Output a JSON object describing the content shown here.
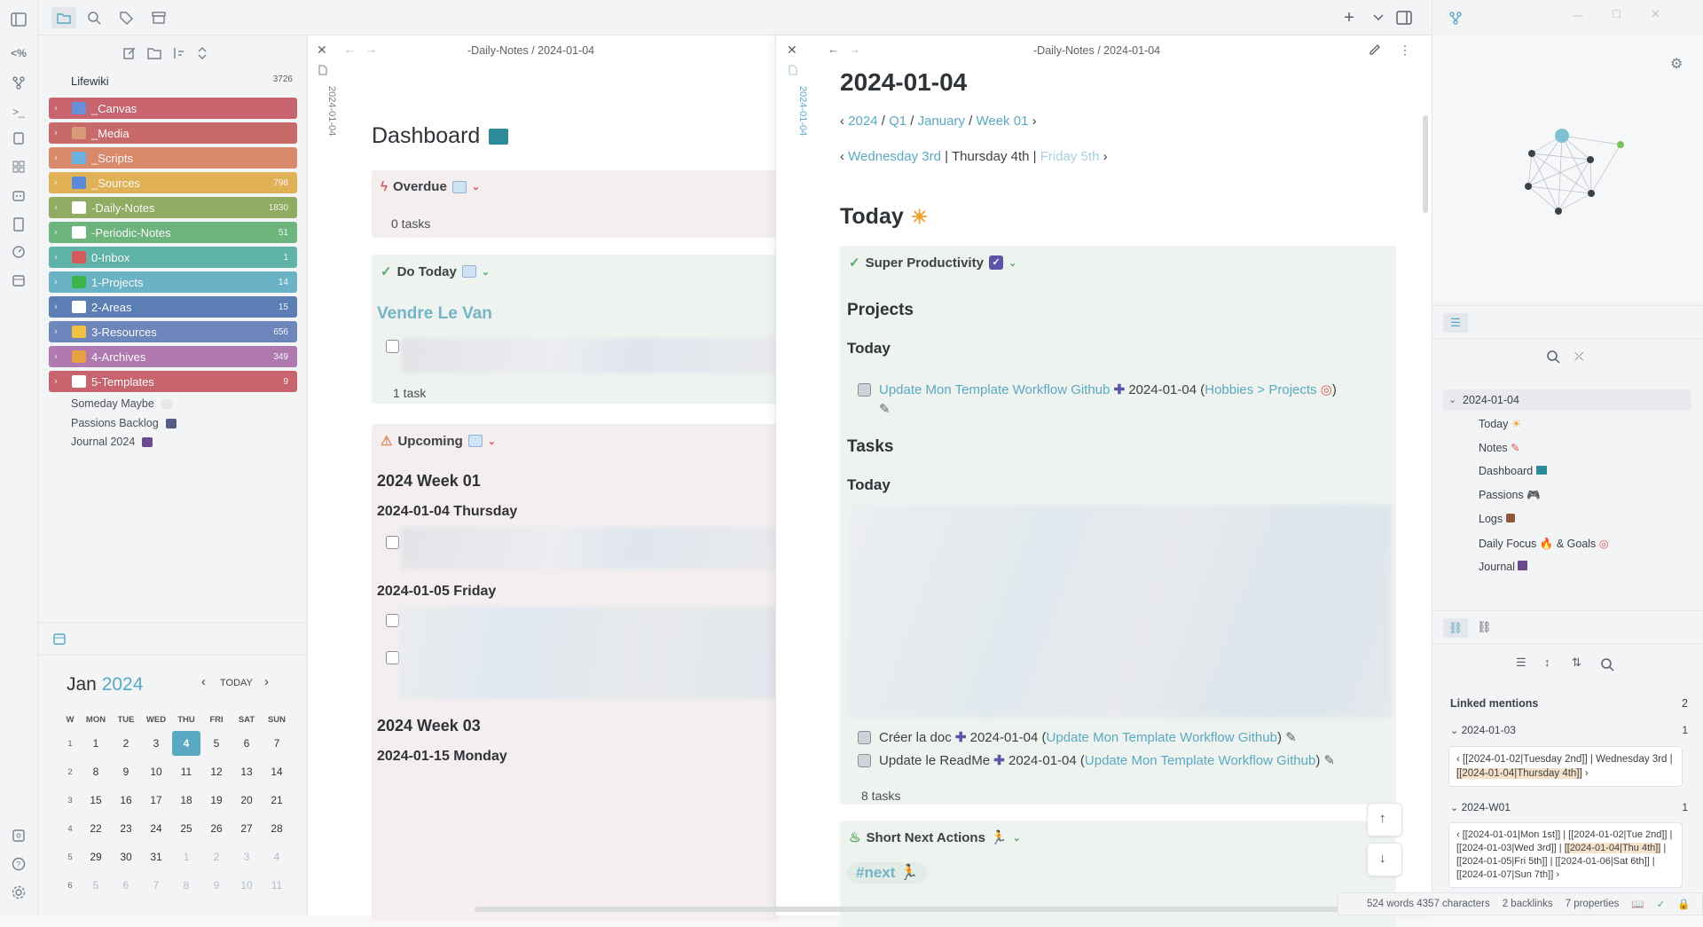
{
  "vault": {
    "name": "Lifewiki",
    "count": "3726"
  },
  "folders": [
    {
      "name": "_Canvas",
      "count": "",
      "color": "#c7646e",
      "icon_color": "#6a8fd9"
    },
    {
      "name": "_Media",
      "count": "",
      "color": "#c96a6a",
      "icon_color": "#d99a7a"
    },
    {
      "name": "_Scripts",
      "count": "",
      "color": "#d98a6a",
      "icon_color": "#6ab0e0"
    },
    {
      "name": "_Sources",
      "count": "798",
      "color": "#e0b255",
      "icon_color": "#5a8ad9"
    },
    {
      "name": "-Daily-Notes",
      "count": "1830",
      "color": "#8fac62",
      "icon_color": "#ffffff"
    },
    {
      "name": "-Periodic-Notes",
      "count": "51",
      "color": "#6cb57d",
      "icon_color": "#ffffff"
    },
    {
      "name": "0-Inbox",
      "count": "1",
      "color": "#5fb3a8",
      "icon_color": "#d65a5a"
    },
    {
      "name": "1-Projects",
      "count": "14",
      "color": "#6ab3c6",
      "icon_color": "#3bb54a"
    },
    {
      "name": "2-Areas",
      "count": "15",
      "color": "#5b7fb5",
      "icon_color": "#ffffff"
    },
    {
      "name": "3-Resources",
      "count": "656",
      "color": "#6d86bb",
      "icon_color": "#f0c040"
    },
    {
      "name": "4-Archives",
      "count": "349",
      "color": "#b07ab0",
      "icon_color": "#e8a040"
    },
    {
      "name": "5-Templates",
      "count": "9",
      "color": "#c7646e",
      "icon_color": "#ffffff"
    }
  ],
  "files": [
    {
      "name": "Someday Maybe",
      "emoji_color": "#e8e8ea"
    },
    {
      "name": "Passions Backlog",
      "emoji_color": "#555a88"
    },
    {
      "name": "Journal 2024",
      "emoji_color": "#6a4a8a"
    }
  ],
  "calendar": {
    "month": "Jan",
    "year": "2024",
    "today_label": "TODAY",
    "weekdays": [
      "W",
      "MON",
      "TUE",
      "WED",
      "THU",
      "FRI",
      "SAT",
      "SUN"
    ],
    "weeks": [
      [
        "1",
        "1",
        "2",
        "3",
        "4",
        "5",
        "6",
        "7"
      ],
      [
        "2",
        "8",
        "9",
        "10",
        "11",
        "12",
        "13",
        "14"
      ],
      [
        "3",
        "15",
        "16",
        "17",
        "18",
        "19",
        "20",
        "21"
      ],
      [
        "4",
        "22",
        "23",
        "24",
        "25",
        "26",
        "27",
        "28"
      ],
      [
        "5",
        "29",
        "30",
        "31",
        "1",
        "2",
        "3",
        "4"
      ],
      [
        "6",
        "5",
        "6",
        "7",
        "8",
        "9",
        "10",
        "11"
      ]
    ],
    "today": "4"
  },
  "pane1": {
    "breadcrumb": "-Daily-Notes / 2024-01-04",
    "vertical_title": "2024-01-04",
    "title": "Dashboard",
    "overdue": {
      "title": "Overdue",
      "count": "0 tasks"
    },
    "do_today": {
      "title": "Do Today",
      "heading": "Vendre Le Van",
      "count": "1 task"
    },
    "upcoming": {
      "title": "Upcoming",
      "week1": "2024 Week 01",
      "day1": "2024-01-04 Thursday",
      "day2": "2024-01-05 Friday",
      "week3": "2024 Week 03",
      "day3": "2024-01-15 Monday"
    }
  },
  "pane2": {
    "breadcrumb": "-Daily-Notes / 2024-01-04",
    "vertical_title": "2024-01-04",
    "title": "2024-01-04",
    "crumbs": [
      "2024",
      "Q1",
      "January",
      "Week 01"
    ],
    "prev_day": "Wednesday 3rd",
    "current_day": "Thursday 4th",
    "next_day": "Friday 5th",
    "today_heading": "Today",
    "sp_title": "Super Productivity",
    "projects": "Projects",
    "today1": "Today",
    "task1_link": "Update Mon Template Workflow Github",
    "task1_date": "2024-01-04",
    "task1_ctx": "Hobbies > Projects",
    "tasks": "Tasks",
    "today2": "Today",
    "task2_text": "Créer la doc",
    "task2_date": "2024-01-04",
    "task2_link": "Update Mon Template Workflow Github",
    "task3_text": "Update le ReadMe",
    "task3_date": "2024-01-04",
    "task3_link": "Update Mon Template Workflow Github",
    "tasks_count": "8 tasks",
    "sna_title": "Short Next Actions",
    "next_tag": "#next"
  },
  "outline": {
    "root": "2024-01-04",
    "items": [
      "Today",
      "Notes",
      "Dashboard",
      "Passions",
      "Logs",
      "Daily Focus",
      "& Goals",
      "Journal"
    ]
  },
  "backlinks": {
    "label": "Linked mentions",
    "count": "2",
    "groups": [
      {
        "title": "2024-01-03",
        "count": "1",
        "pre": "[[2024-01-02|Tuesday 2nd]] | Wednesday 3rd | ",
        "hl": "[[2024-01-04|Thursday 4th]]"
      },
      {
        "title": "2024-W01",
        "count": "1",
        "pre": "[[2024-01-01|Mon 1st]] | [[2024-01-02|Tue 2nd]] | [[2024-01-03|Wed 3rd]] | ",
        "hl": "[[2024-01-04|Thu 4th]]",
        "post": " | [[2024-01-05|Fri 5th]] | [[2024-01-06|Sat 6th]] | [[2024-01-07|Sun 7th]]"
      }
    ]
  },
  "status": {
    "words": "524 words 4357 characters",
    "backlinks": "2 backlinks",
    "properties": "7 properties"
  }
}
